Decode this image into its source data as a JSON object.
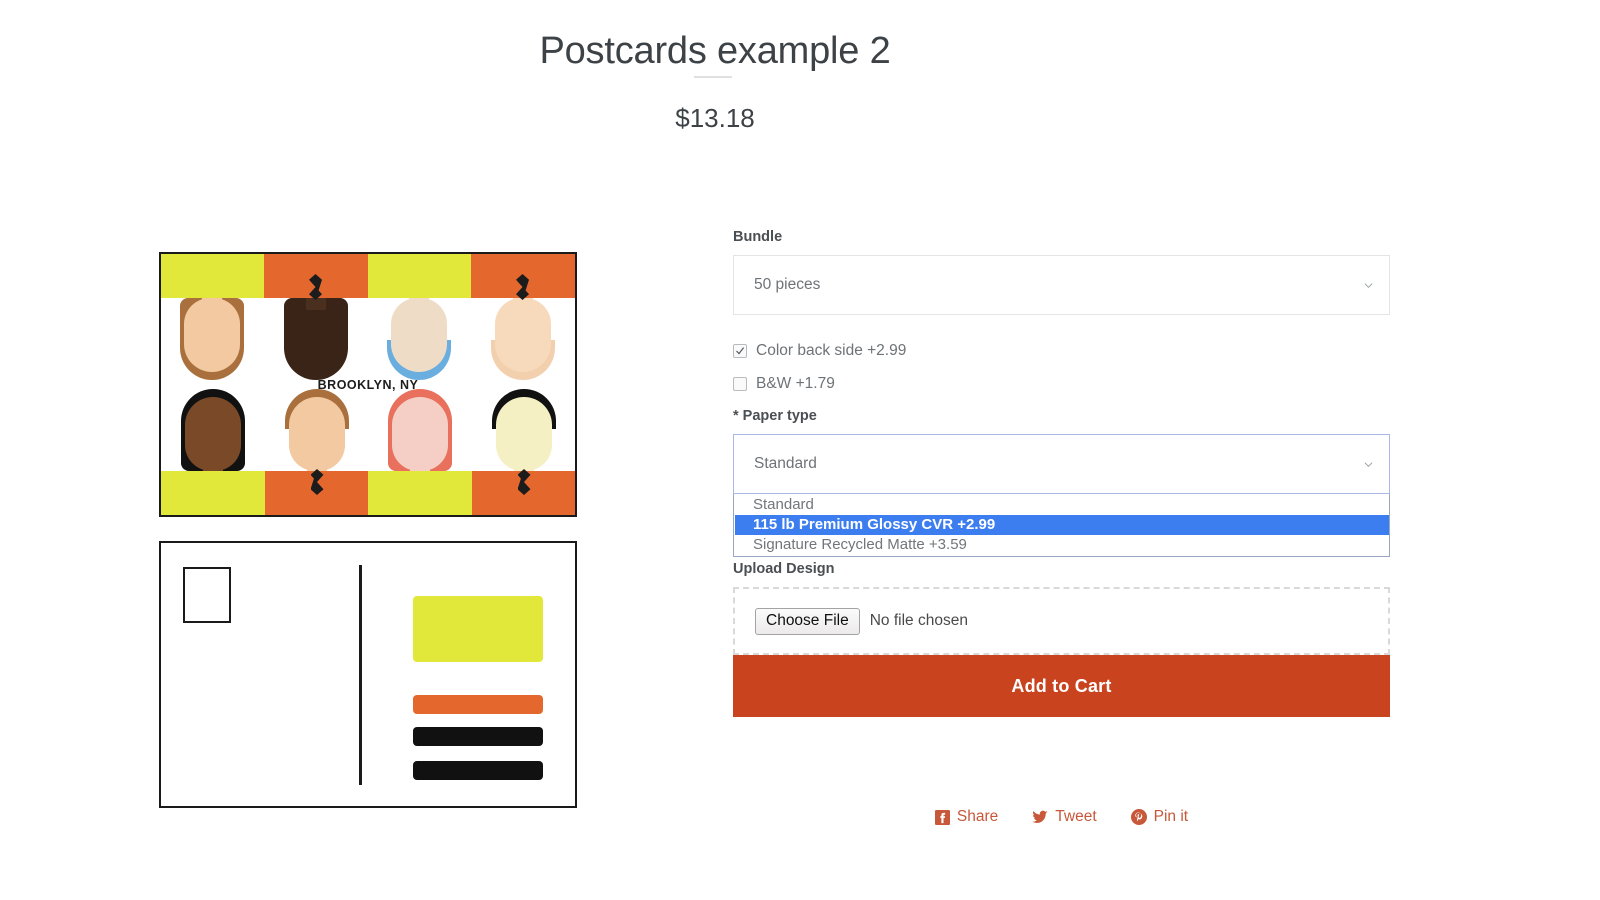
{
  "product": {
    "title": "Postcards example 2",
    "price": "$13.18"
  },
  "gallery": {
    "front": {
      "city_label": "BROOKLYN, NY",
      "alt": "postcard-front-illustration"
    },
    "back": {
      "alt": "postcard-back-layout"
    }
  },
  "form": {
    "bundle": {
      "label": "Bundle",
      "selected": "50 pieces"
    },
    "checkboxes": [
      {
        "label": "Color back side +2.99",
        "checked": true
      },
      {
        "label": "B&W +1.79",
        "checked": false
      }
    ],
    "paper_type": {
      "label": "* Paper type",
      "selected": "Standard",
      "expanded": true,
      "options": [
        {
          "label": "Standard",
          "highlighted": false
        },
        {
          "label": "115 lb Premium Glossy CVR +2.99",
          "highlighted": true
        },
        {
          "label": "Signature Recycled Matte +3.59",
          "highlighted": false
        }
      ]
    },
    "upload": {
      "label": "Upload Design",
      "button": "Choose File",
      "status": "No file chosen"
    },
    "submit": "Add to Cart"
  },
  "share": [
    {
      "label": "Share",
      "icon": "facebook-icon"
    },
    {
      "label": "Tweet",
      "icon": "twitter-icon"
    },
    {
      "label": "Pin it",
      "icon": "pinterest-icon"
    }
  ],
  "colors": {
    "accent": "#c8431e",
    "highlight": "#3c7ef0",
    "share_link": "#c8583a"
  }
}
